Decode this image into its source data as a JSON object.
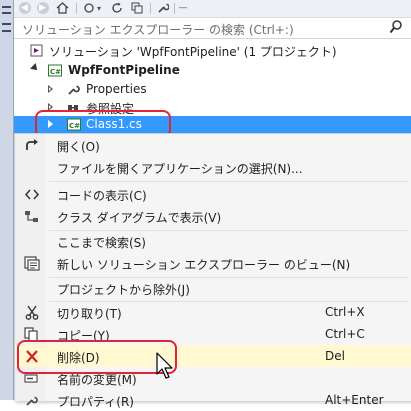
{
  "search": {
    "placeholder": "ソリューション エクスプローラー の検索 (Ctrl+:)"
  },
  "tree": {
    "solution_label": "ソリューション 'WpfFontPipeline' (1 プロジェクト)",
    "project_label": "WpfFontPipeline",
    "items": [
      {
        "label": "Properties"
      },
      {
        "label": "参照設定"
      },
      {
        "label": "Class1.cs"
      }
    ]
  },
  "context_menu": {
    "items": [
      {
        "label": "開く(O)",
        "shortcut": ""
      },
      {
        "label": "ファイルを開くアプリケーションの選択(N)...",
        "shortcut": ""
      },
      {
        "label": "コードの表示(C)",
        "shortcut": ""
      },
      {
        "label": "クラス ダイアグラムで表示(V)",
        "shortcut": ""
      },
      {
        "label": "ここまで検索(S)",
        "shortcut": ""
      },
      {
        "label": "新しい ソリューション エクスプローラー のビュー(N)",
        "shortcut": ""
      },
      {
        "label": "プロジェクトから除外(J)",
        "shortcut": ""
      },
      {
        "label": "切り取り(T)",
        "shortcut": "Ctrl+X"
      },
      {
        "label": "コピー(Y)",
        "shortcut": "Ctrl+C"
      },
      {
        "label": "削除(D)",
        "shortcut": "Del"
      },
      {
        "label": "名前の変更(M)",
        "shortcut": ""
      },
      {
        "label": "プロパティ(R)",
        "shortcut": "Alt+Enter"
      }
    ]
  },
  "colors": {
    "selection": "#3399ff",
    "highlight_outline": "#e0243a",
    "delete_hover": "#fff8d0"
  }
}
